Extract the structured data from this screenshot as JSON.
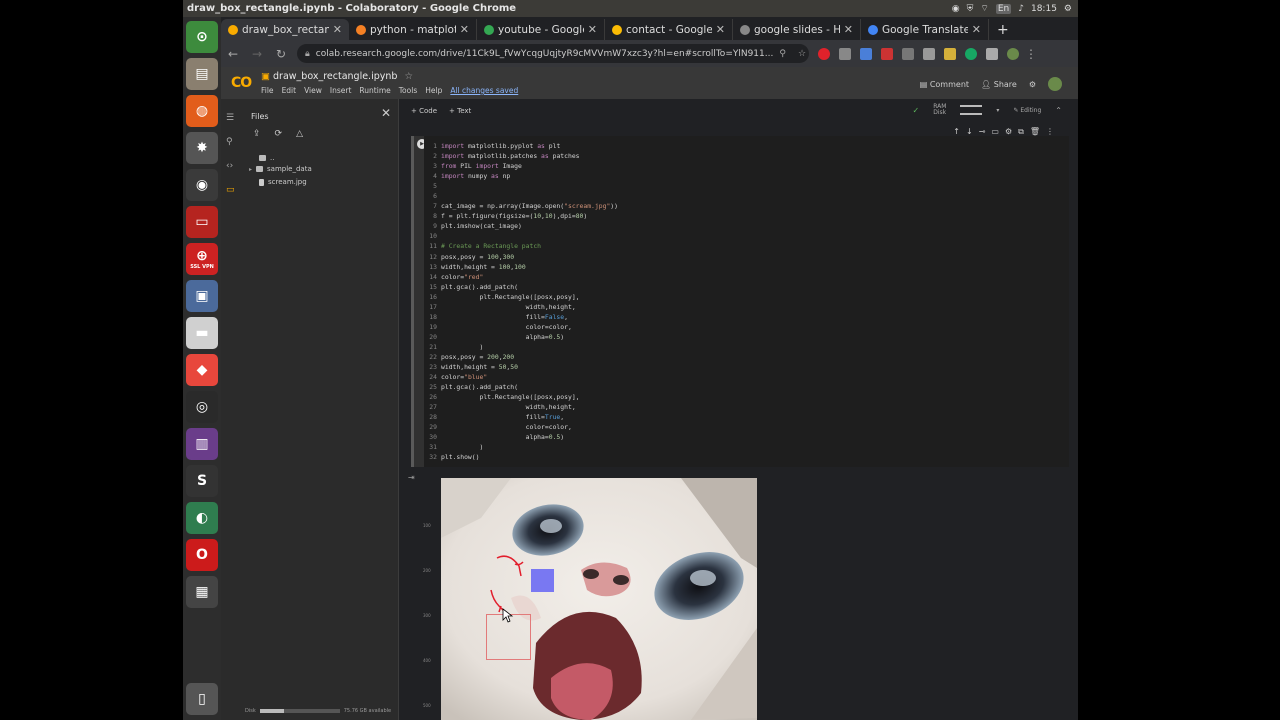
{
  "os": {
    "window_title": "draw_box_rectangle.ipynb - Colaboratory - Google Chrome",
    "tray_indicator": "En",
    "clock": "18:15"
  },
  "dock": [
    "terminal-icon",
    "files-icon",
    "firefox-icon",
    "settings-icon",
    "chrome-icon",
    "presentation-icon",
    "ssl-vpn-icon",
    "remote-desktop-icon",
    "drive-icon",
    "anydesk-icon",
    "obs-icon",
    "media-icon",
    "sublime-icon",
    "app-icon",
    "opera-icon",
    "folder-icon",
    "trash-icon"
  ],
  "ssl_vpn_label": "SSL VPN",
  "tabs": [
    {
      "label": "draw_box_rectangle",
      "icon": "colab-icon",
      "color": "#f9ab00",
      "active": true
    },
    {
      "label": "python - matplotlib",
      "icon": "stackoverflow-icon",
      "color": "#f48024"
    },
    {
      "label": "youtube - Google S",
      "icon": "drive-icon",
      "color": "#34a853"
    },
    {
      "label": "contact - Google S",
      "icon": "slides-icon",
      "color": "#fbbc04"
    },
    {
      "label": "google slides - Ho",
      "icon": "globe-icon",
      "color": "#888888"
    },
    {
      "label": "Google Translate",
      "icon": "translate-icon",
      "color": "#4285f4"
    }
  ],
  "url": "colab.research.google.com/drive/11Ck9L_fVwYcqgUqjtyR9cMVVmW7xzc3y?hl=en#scrollTo=YlN911...",
  "colab": {
    "notebook_name": "draw_box_rectangle.ipynb",
    "menus": [
      "File",
      "Edit",
      "View",
      "Insert",
      "Runtime",
      "Tools",
      "Help"
    ],
    "saved_status": "All changes saved",
    "comment_label": "Comment",
    "share_label": "Share",
    "add_code": "+ Code",
    "add_text": "+ Text",
    "ram_label": "RAM",
    "disk_label": "Disk",
    "editing_label": "Editing"
  },
  "files": {
    "title": "Files",
    "parent": "..",
    "items": [
      {
        "name": "sample_data",
        "type": "folder"
      },
      {
        "name": "scream.jpg",
        "type": "file"
      }
    ],
    "disk_label": "Disk",
    "disk_status": "75.76 GB available",
    "disk_fill": 0.3
  },
  "code_lines": [
    [
      [
        "kw",
        "import"
      ],
      [
        "t",
        " matplotlib.pyplot "
      ],
      [
        "kw",
        "as"
      ],
      [
        "t",
        " plt"
      ]
    ],
    [
      [
        "kw",
        "import"
      ],
      [
        "t",
        " matplotlib.patches "
      ],
      [
        "kw",
        "as"
      ],
      [
        "t",
        " patches"
      ]
    ],
    [
      [
        "kw",
        "from"
      ],
      [
        "t",
        " PIL "
      ],
      [
        "kw",
        "import"
      ],
      [
        "t",
        " Image"
      ]
    ],
    [
      [
        "kw",
        "import"
      ],
      [
        "t",
        " numpy "
      ],
      [
        "kw",
        "as"
      ],
      [
        "t",
        " np"
      ]
    ],
    [],
    [],
    [
      [
        "t",
        "cat_image = np.array(Image.open("
      ],
      [
        "st",
        "\"scream.jpg\""
      ],
      [
        "t",
        "))"
      ]
    ],
    [
      [
        "t",
        "f = plt.figure(figsize=("
      ],
      [
        "nu",
        "10"
      ],
      [
        "t",
        ","
      ],
      [
        "nu",
        "10"
      ],
      [
        "t",
        "),dpi="
      ],
      [
        "nu",
        "80"
      ],
      [
        "t",
        ")"
      ]
    ],
    [
      [
        "t",
        "plt.imshow(cat_image)"
      ]
    ],
    [],
    [
      [
        "cm",
        "# Create a Rectangle patch"
      ]
    ],
    [
      [
        "t",
        "posx,posy = "
      ],
      [
        "nu",
        "100"
      ],
      [
        "t",
        ","
      ],
      [
        "nu",
        "300"
      ]
    ],
    [
      [
        "t",
        "width,height = "
      ],
      [
        "nu",
        "100"
      ],
      [
        "t",
        ","
      ],
      [
        "nu",
        "100"
      ]
    ],
    [
      [
        "t",
        "color="
      ],
      [
        "st",
        "\"red\""
      ]
    ],
    [
      [
        "t",
        "plt.gca().add_patch("
      ]
    ],
    [
      [
        "t",
        "          plt.Rectangle([posx,posy],"
      ]
    ],
    [
      [
        "t",
        "                      width,height,"
      ]
    ],
    [
      [
        "t",
        "                      fill="
      ],
      [
        "bi",
        "False"
      ],
      [
        "t",
        ","
      ]
    ],
    [
      [
        "t",
        "                      color=color,"
      ]
    ],
    [
      [
        "t",
        "                      alpha="
      ],
      [
        "nu",
        "0.5"
      ],
      [
        "t",
        ")"
      ]
    ],
    [
      [
        "t",
        "          )"
      ]
    ],
    [
      [
        "t",
        "posx,posy = "
      ],
      [
        "nu",
        "200"
      ],
      [
        "t",
        ","
      ],
      [
        "nu",
        "200"
      ]
    ],
    [
      [
        "t",
        "width,height = "
      ],
      [
        "nu",
        "50"
      ],
      [
        "t",
        ","
      ],
      [
        "nu",
        "50"
      ]
    ],
    [
      [
        "t",
        "color="
      ],
      [
        "st",
        "\"blue\""
      ]
    ],
    [
      [
        "t",
        "plt.gca().add_patch("
      ]
    ],
    [
      [
        "t",
        "          plt.Rectangle([posx,posy],"
      ]
    ],
    [
      [
        "t",
        "                      width,height,"
      ]
    ],
    [
      [
        "t",
        "                      fill="
      ],
      [
        "bi",
        "True"
      ],
      [
        "t",
        ","
      ]
    ],
    [
      [
        "t",
        "                      color=color,"
      ]
    ],
    [
      [
        "t",
        "                      alpha="
      ],
      [
        "nu",
        "0.5"
      ],
      [
        "t",
        ")"
      ]
    ],
    [
      [
        "t",
        "          )"
      ]
    ],
    [
      [
        "t",
        "plt.show()"
      ]
    ]
  ],
  "output": {
    "yticks": [
      "100",
      "200",
      "300",
      "400",
      "500"
    ],
    "blue_rect_color": "#5b5bf5",
    "red_rect_color": "#e27a7a"
  }
}
